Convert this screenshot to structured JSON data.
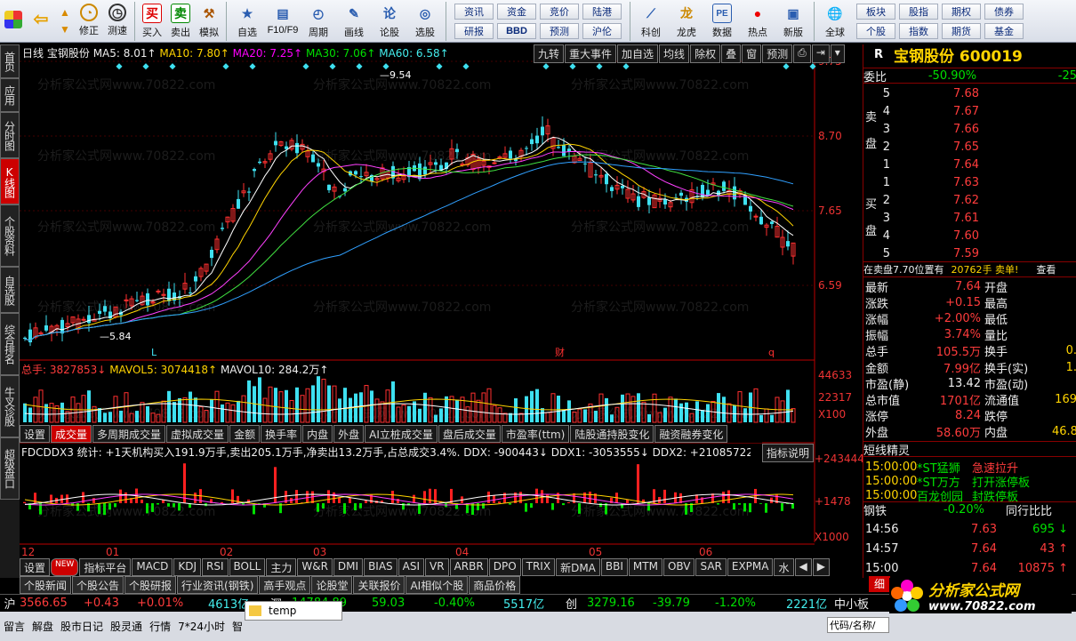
{
  "toolbar": {
    "buttons": [
      "修正",
      "测速",
      "买入",
      "卖出",
      "模拟",
      "自选",
      "F10/F9",
      "周期",
      "画线",
      "论股",
      "选股",
      "科创",
      "龙虎",
      "数据",
      "热点",
      "新版",
      "全球"
    ],
    "grid1": [
      "资讯",
      "资金",
      "竞价",
      "陆港",
      "研报",
      "BBD",
      "预测",
      "沪伦"
    ],
    "grid2": [
      "板块",
      "股指",
      "期权",
      "债券",
      "个股",
      "指数",
      "期货",
      "基金"
    ]
  },
  "lefttabs": [
    "首页",
    "应用",
    "分时图",
    "K线图",
    "个股资料",
    "自选股",
    "综合排名",
    "牛叉诊股",
    "超级盘口"
  ],
  "chart": {
    "topline": {
      "period": "日线",
      "name": "宝钢股份",
      "ma5": "MA5: 8.01↑",
      "ma10": "MA10: 7.80↑",
      "ma20": "MA20: 7.25↑",
      "ma30": "MA30: 7.06↑",
      "ma60": "MA60: 6.58↑"
    },
    "tools": [
      "九转",
      "重大事件",
      "加自选",
      "均线",
      "除权",
      "叠",
      "窗",
      "预测"
    ],
    "price_ticks": [
      "9.75",
      "8.70",
      "7.65",
      "6.59"
    ],
    "hi_label": "9.54",
    "lo_label": "5.84",
    "vol_line": {
      "a": "总手: 3827853↓",
      "b": "MAVOL5: 3074418↑",
      "c": "MAVOL10: 284.2万↑"
    },
    "vol_ticks": [
      "44633",
      "22317",
      "X100"
    ],
    "ddx_line": "FDCDDX3 统计: +1天机构买入191.9万手,卖出205.1万手,净卖出13.2万手,占总成交3.4%. DDX: -900443↓ DDX1: -3053555↓ DDX2: +21085722↓ DDX3: +5",
    "ddx_tip": "指标说明",
    "ddx_ticks": [
      "+243444",
      "+1478",
      "X1000"
    ],
    "months": [
      "12",
      "01",
      "02",
      "03",
      "04",
      "05",
      "06"
    ],
    "markers": [
      "L",
      "财",
      "q"
    ],
    "watermark": "分析家公式网www.70822.com"
  },
  "funcbar": [
    "设置",
    "成交量",
    "多周期成交量",
    "虚拟成交量",
    "金额",
    "换手率",
    "内盘",
    "外盘",
    "AI立桩成交量",
    "盘后成交量",
    "市盈率(ttm)",
    "陆股通持股变化",
    "融资融券变化"
  ],
  "idxbar": [
    "设置",
    "NEW",
    "指标平台",
    "MACD",
    "KDJ",
    "RSI",
    "BOLL",
    "主力",
    "W&R",
    "DMI",
    "BIAS",
    "ASI",
    "VR",
    "ARBR",
    "DPO",
    "TRIX",
    "新DMA",
    "BBI",
    "MTM",
    "OBV",
    "SAR",
    "EXPMA",
    "水"
  ],
  "newsbar": [
    "个股新闻",
    "个股公告",
    "个股研报",
    "行业资讯(钢铁)",
    "高手观点",
    "论股堂",
    "关联报价",
    "AI相似个股",
    "商品价格"
  ],
  "right": {
    "title": "宝钢股份 600019",
    "r": "R",
    "weibi": "委比",
    "weibi_val": "-50.90%",
    "weibi_r": "-25",
    "sell_label": "卖盘",
    "buy_label": "买盘",
    "sells": [
      {
        "n": "5",
        "p": "7.68"
      },
      {
        "n": "4",
        "p": "7.67"
      },
      {
        "n": "3",
        "p": "7.66"
      },
      {
        "n": "2",
        "p": "7.65"
      },
      {
        "n": "1",
        "p": "7.64"
      }
    ],
    "buys": [
      {
        "n": "1",
        "p": "7.63"
      },
      {
        "n": "2",
        "p": "7.62"
      },
      {
        "n": "3",
        "p": "7.61"
      },
      {
        "n": "4",
        "p": "7.60"
      },
      {
        "n": "5",
        "p": "7.59"
      }
    ],
    "note": "在卖盘7.70位置有",
    "note2": "20762手 卖单!",
    "note3": "查看",
    "stats": [
      [
        "最新",
        "7.64",
        "开盘",
        ""
      ],
      [
        "涨跌",
        "+0.15",
        "最高",
        ""
      ],
      [
        "涨幅",
        "+2.00%",
        "最低",
        ""
      ],
      [
        "振幅",
        "3.74%",
        "量比",
        ""
      ],
      [
        "总手",
        "105.5万",
        "换手",
        "0."
      ],
      [
        "金额",
        "7.99亿",
        "换手(实)",
        "1."
      ],
      [
        "市盈(静)",
        "13.42",
        "市盈(动)",
        ""
      ],
      [
        "总市值",
        "1701亿",
        "流通值",
        "169"
      ],
      [
        "涨停",
        "8.24",
        "跌停",
        ""
      ],
      [
        "外盘",
        "58.60万",
        "内盘",
        "46.8"
      ]
    ],
    "news_title": "短线精灵",
    "news": [
      [
        "15:00:00",
        "*ST猛狮",
        "急速拉升"
      ],
      [
        "15:00:00",
        "*ST万方",
        "打开涨停板"
      ],
      [
        "15:00:00",
        "百龙创园",
        "封跌停板"
      ]
    ],
    "sector": "钢铁",
    "sector_chg": "-0.20%",
    "sector_r": "同行比比",
    "ticks": [
      [
        "14:56",
        "7.63",
        "695"
      ],
      [
        "14:57",
        "7.64",
        "43"
      ],
      [
        "15:00",
        "7.64",
        "10875"
      ]
    ],
    "tab": "细"
  },
  "status": {
    "sh": "沪",
    "sh_val": "3566.65",
    "sh_chg": "+0.43",
    "sh_pct": "+0.01%",
    "sh_amt": "4613亿",
    "sz": "深",
    "sz_val": "14784.89",
    "sz_chg": "59.03",
    "sz_pct": "-0.40%",
    "sz_amt": "5517亿",
    "cy": "创",
    "cy_val": "3279.16",
    "cy_chg": "-39.79",
    "cy_pct": "-1.20%",
    "cy_amt": "2221亿",
    "tail": "中小板"
  },
  "bottom": {
    "items": [
      "留言",
      "解盘",
      "股市日记",
      "股灵通",
      "行情",
      "7*24小时",
      "智"
    ],
    "popup": "temp",
    "input": "代码/名称/"
  },
  "logo": {
    "text": "分析家公式网",
    "url": "www.70822.com"
  }
}
